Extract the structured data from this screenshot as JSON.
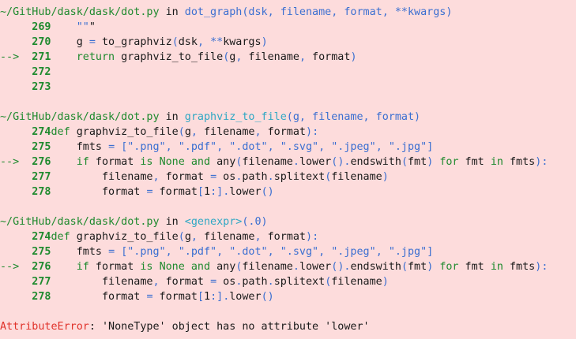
{
  "frame1": {
    "path": "~/GitHub/dask/dask/dot.py",
    "in": "in",
    "func": "dot_graph",
    "args": "(dsk, filename, format, **kwargs)",
    "lines": [
      {
        "marker": "   ",
        "num": "269",
        "code": "    \"\"\""
      },
      {
        "marker": "   ",
        "num": "270",
        "code": "    g = to_graphviz(dsk, **kwargs)"
      },
      {
        "marker": "-->",
        "num": "271",
        "code": "    return graphviz_to_file(g, filename, format)"
      },
      {
        "marker": "   ",
        "num": "272",
        "code": ""
      },
      {
        "marker": "   ",
        "num": "273",
        "code": ""
      }
    ]
  },
  "frame2": {
    "path": "~/GitHub/dask/dask/dot.py",
    "in": "in",
    "func": "graphviz_to_file",
    "args": "(g, filename, format)",
    "lines": [
      {
        "marker": "   ",
        "num": "274",
        "code": "def graphviz_to_file(g, filename, format):"
      },
      {
        "marker": "   ",
        "num": "275",
        "code": "    fmts = [\".png\", \".pdf\", \".dot\", \".svg\", \".jpeg\", \".jpg\"]"
      },
      {
        "marker": "-->",
        "num": "276",
        "code": "    if format is None and any(filename.lower().endswith(fmt) for fmt in fmts):"
      },
      {
        "marker": "   ",
        "num": "277",
        "code": "        filename, format = os.path.splitext(filename)"
      },
      {
        "marker": "   ",
        "num": "278",
        "code": "        format = format[1:].lower()"
      }
    ]
  },
  "frame3": {
    "path": "~/GitHub/dask/dask/dot.py",
    "in": "in",
    "func": "<genexpr>",
    "args": "(.0)",
    "lines": [
      {
        "marker": "   ",
        "num": "274",
        "code": "def graphviz_to_file(g, filename, format):"
      },
      {
        "marker": "   ",
        "num": "275",
        "code": "    fmts = [\".png\", \".pdf\", \".dot\", \".svg\", \".jpeg\", \".jpg\"]"
      },
      {
        "marker": "-->",
        "num": "276",
        "code": "    if format is None and any(filename.lower().endswith(fmt) for fmt in fmts):"
      },
      {
        "marker": "   ",
        "num": "277",
        "code": "        filename, format = os.path.splitext(filename)"
      },
      {
        "marker": "   ",
        "num": "278",
        "code": "        format = format[1:].lower()"
      }
    ]
  },
  "error": {
    "type": "AttributeError",
    "message": ": 'NoneType' object has no attribute 'lower'"
  },
  "colors": {
    "background": "#fddcdc",
    "path": "#1f8a2e",
    "func_primary": "#3b6fd1",
    "func_secondary": "#30a8c4",
    "error": "#e0322a"
  }
}
